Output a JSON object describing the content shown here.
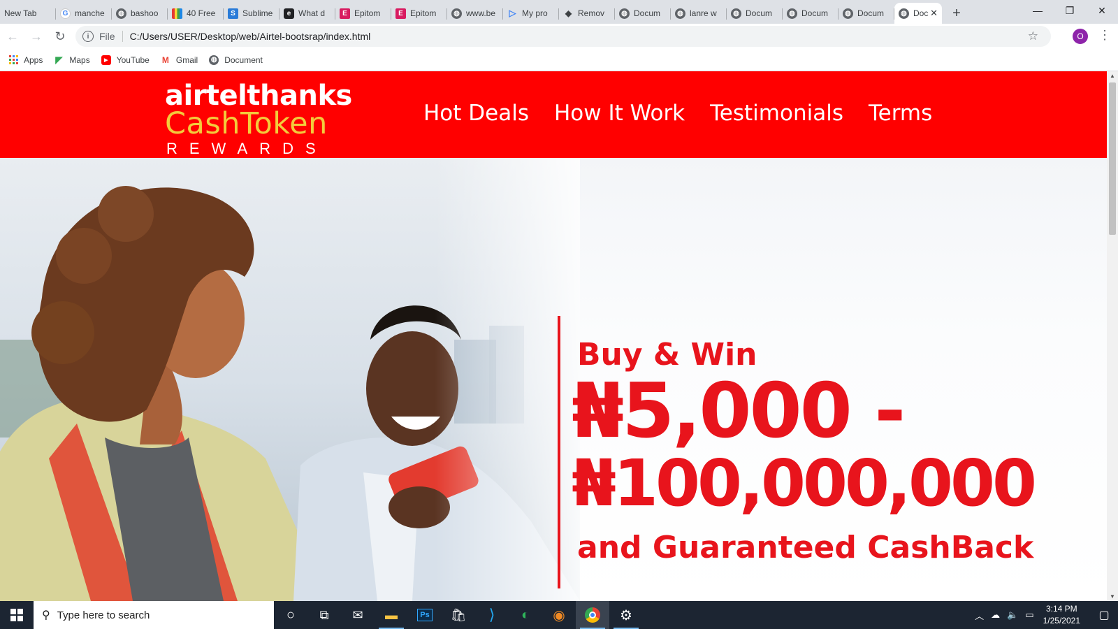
{
  "browser": {
    "tabs": [
      {
        "label": "New Tab",
        "icon": "none"
      },
      {
        "label": "manche",
        "icon": "google-icon"
      },
      {
        "label": "bashoo",
        "icon": "globe-icon"
      },
      {
        "label": "40 Free",
        "icon": "color-bars-icon"
      },
      {
        "label": "Sublime",
        "icon": "sublime-icon"
      },
      {
        "label": "What d",
        "icon": "app-icon"
      },
      {
        "label": "Epitom",
        "icon": "e-icon"
      },
      {
        "label": "Epitom",
        "icon": "e-icon"
      },
      {
        "label": "www.be",
        "icon": "globe-icon"
      },
      {
        "label": "My pro",
        "icon": "play-icon"
      },
      {
        "label": "Remov",
        "icon": "grad-cap-icon"
      },
      {
        "label": "Docum",
        "icon": "globe-icon"
      },
      {
        "label": "lanre w",
        "icon": "globe-icon"
      },
      {
        "label": "Docum",
        "icon": "globe-icon"
      },
      {
        "label": "Docum",
        "icon": "globe-icon"
      },
      {
        "label": "Docum",
        "icon": "globe-icon"
      }
    ],
    "active_tab": {
      "label": "Doc",
      "close": "✕"
    },
    "new_tab_symbol": "+",
    "address": {
      "scheme": "File",
      "url": "C:/Users/USER/Desktop/web/Airtel-bootsrap/index.html"
    },
    "profile_initial": "O",
    "bookmarks": [
      {
        "label": "Apps",
        "icon": "apps-grid-icon"
      },
      {
        "label": "Maps",
        "icon": "maps-icon"
      },
      {
        "label": "YouTube",
        "icon": "youtube-icon"
      },
      {
        "label": "Gmail",
        "icon": "gmail-icon"
      },
      {
        "label": "Document",
        "icon": "globe-icon"
      }
    ]
  },
  "site": {
    "logo": {
      "line1": "airtelthanks",
      "line2": "CashToken",
      "line3": "REWARDS"
    },
    "nav": [
      "Hot Deals",
      "How It Work",
      "Testimonials",
      "Terms"
    ],
    "hero": {
      "headline": "Buy & Win",
      "amount_low": "₦5,000 -",
      "amount_high": "₦100,000,000",
      "subline": "and Guaranteed CashBack"
    }
  },
  "taskbar": {
    "search_placeholder": "Type here to search",
    "time": "3:14 PM",
    "date": "1/25/2021"
  },
  "colors": {
    "brand_red": "#ff0000",
    "hero_red": "#e8141c",
    "logo_gold": "#f3cc3c",
    "taskbar": "#1c2532"
  }
}
